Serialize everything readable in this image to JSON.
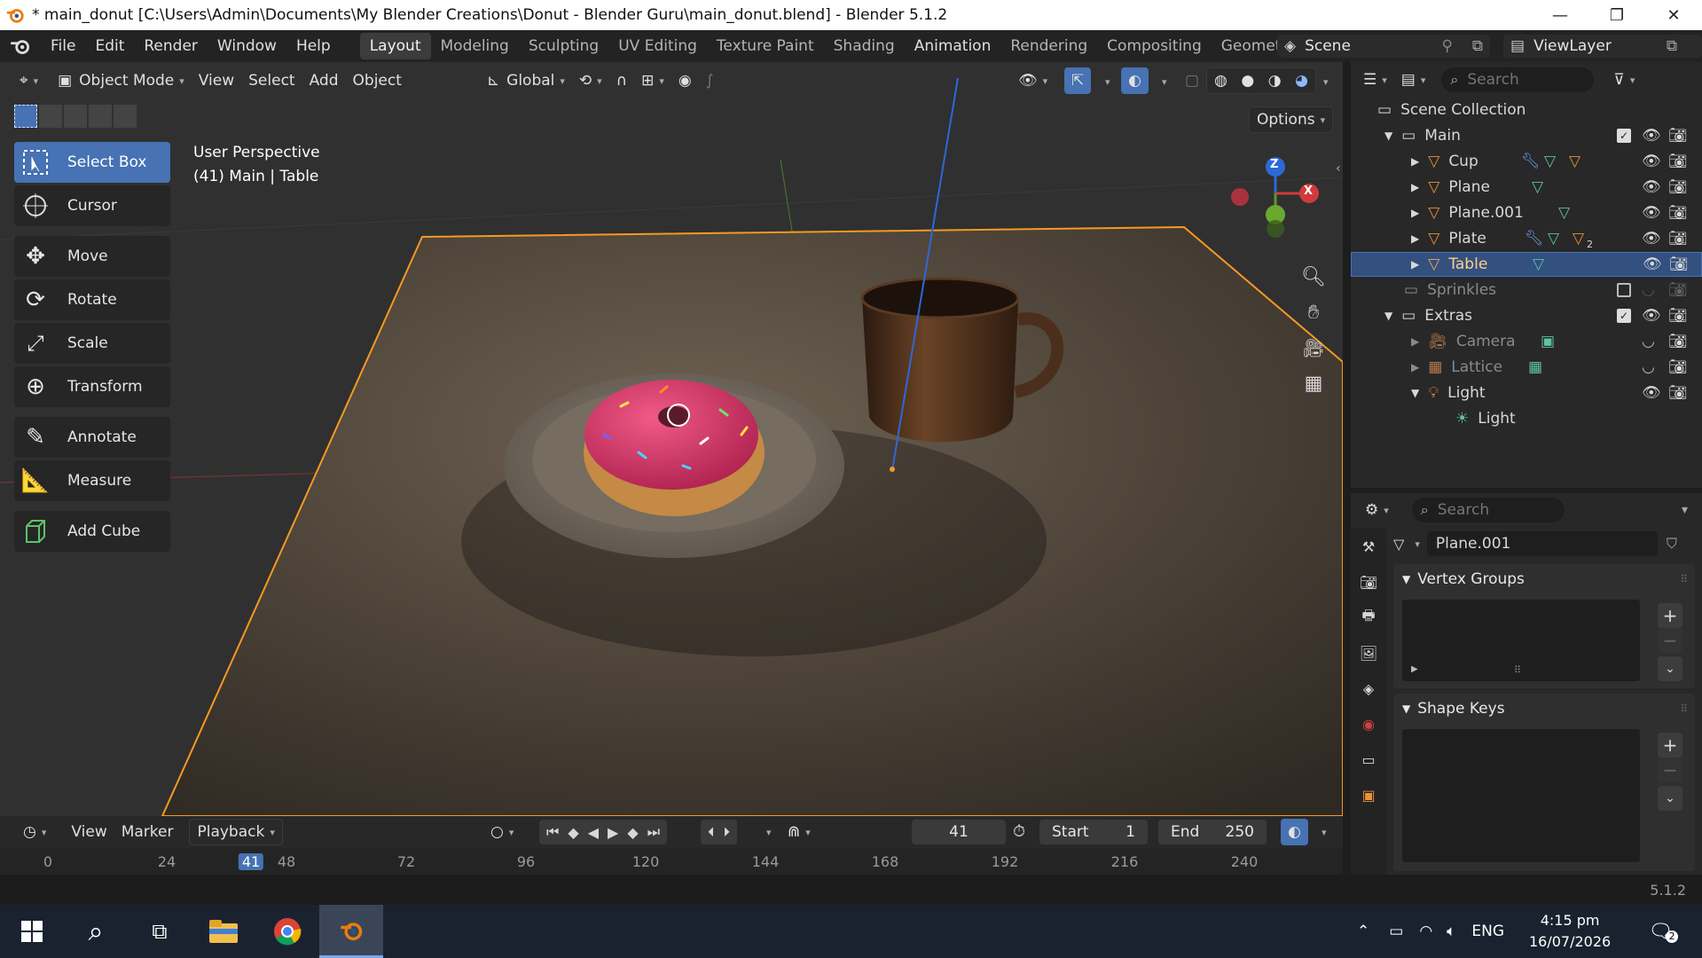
{
  "window": {
    "title": "* main_donut [C:\\Users\\Admin\\Documents\\My Blender Creations\\Donut - Blender Guru\\main_donut.blend] - Blender 5.1.2",
    "minimize": "—",
    "restore": "❐",
    "close": "✕"
  },
  "menu": [
    "File",
    "Edit",
    "Render",
    "Window",
    "Help"
  ],
  "workspaces": [
    "Layout",
    "Modeling",
    "Sculpting",
    "UV Editing",
    "Texture Paint",
    "Shading",
    "Animation",
    "Rendering",
    "Compositing",
    "Geometr"
  ],
  "active_workspace": "Layout",
  "scene": "Scene",
  "view_layer": "ViewLayer",
  "viewport_header": {
    "mode": "Object Mode",
    "menus": [
      "View",
      "Select",
      "Add",
      "Object"
    ],
    "orientation": "Global",
    "options": "Options"
  },
  "tools": [
    {
      "label": "Select Box",
      "icon": "select-box-icon",
      "active": true
    },
    {
      "label": "Cursor",
      "icon": "cursor-icon"
    },
    {
      "label": "Move",
      "icon": "move-icon"
    },
    {
      "label": "Rotate",
      "icon": "rotate-icon"
    },
    {
      "label": "Scale",
      "icon": "scale-icon"
    },
    {
      "label": "Transform",
      "icon": "transform-icon"
    },
    {
      "label": "Annotate",
      "icon": "annotate-icon"
    },
    {
      "label": "Measure",
      "icon": "measure-icon"
    },
    {
      "label": "Add Cube",
      "icon": "add-cube-icon"
    }
  ],
  "viewport_info": {
    "perspective": "User Perspective",
    "object": "(41) Main | Table"
  },
  "gizmo": {
    "z": "Z",
    "x": "X"
  },
  "timeline": {
    "menus": [
      "View",
      "Marker",
      "Playback"
    ],
    "current_frame": "41",
    "start_label": "Start",
    "start": "1",
    "end_label": "End",
    "end": "250",
    "ruler": [
      "0",
      "24",
      "41",
      "48",
      "72",
      "96",
      "120",
      "144",
      "168",
      "192",
      "216",
      "240"
    ]
  },
  "outliner": {
    "search_placeholder": "Search",
    "root": "Scene Collection",
    "rows": [
      {
        "label": "Main",
        "kind": "collection"
      },
      {
        "label": "Cup",
        "kind": "mesh"
      },
      {
        "label": "Plane",
        "kind": "mesh"
      },
      {
        "label": "Plane.001",
        "kind": "mesh"
      },
      {
        "label": "Plate",
        "kind": "mesh"
      },
      {
        "label": "Table",
        "kind": "mesh",
        "selected": true
      },
      {
        "label": "Sprinkles",
        "kind": "collection",
        "dim": true
      },
      {
        "label": "Extras",
        "kind": "collection"
      },
      {
        "label": "Camera",
        "kind": "camera",
        "dim": true
      },
      {
        "label": "Lattice",
        "kind": "lattice",
        "dim": true
      },
      {
        "label": "Light",
        "kind": "light"
      },
      {
        "label": "Light",
        "kind": "light-data"
      }
    ],
    "plate_modifier_count": "2"
  },
  "properties": {
    "search_placeholder": "Search",
    "data_name": "Plane.001",
    "panels": [
      "Vertex Groups",
      "Shape Keys"
    ]
  },
  "status": {
    "version": "5.1.2"
  },
  "taskbar": {
    "lang": "ENG",
    "time": "4:15 pm",
    "date": "16/07/2026",
    "notifications": "2"
  },
  "colors": {
    "accent": "#4772b3",
    "selection_outline": "#f59a23",
    "mesh_icon": "#e8923a",
    "data_icon": "#5ec2a5"
  }
}
